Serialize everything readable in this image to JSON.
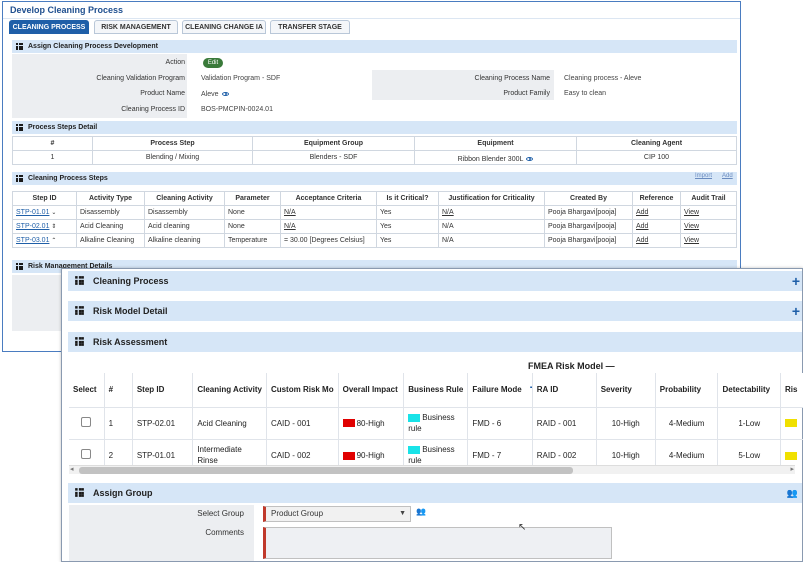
{
  "window": {
    "title": "Develop Cleaning Process"
  },
  "tabs": [
    "CLEANING PROCESS",
    "RISK MANAGEMENT",
    "CLEANING CHANGE IA",
    "TRANSFER STAGE"
  ],
  "assign_section": {
    "title": "Assign Cleaning Process Development",
    "action_label": "Action",
    "edit_label": "Edit",
    "fields": {
      "validation_program_label": "Cleaning Validation Program",
      "validation_program_value": "Validation Program - SDF",
      "product_name_label": "Product Name",
      "product_name_value": "Aleve",
      "process_id_label": "Cleaning Process ID",
      "process_id_value": "BOS-PMCPIN-0024.01",
      "process_name_label": "Cleaning Process Name",
      "process_name_value": "Cleaning process - Aleve",
      "product_family_label": "Product Family",
      "product_family_value": "Easy to clean"
    }
  },
  "steps_detail": {
    "title": "Process Steps Detail",
    "headers": [
      "#",
      "Process Step",
      "Equipment Group",
      "Equipment",
      "Cleaning Agent"
    ],
    "row": [
      "1",
      "Blending / Mixing",
      "Blenders - SDF",
      "Ribbon Blender 300L",
      "CIP 100"
    ]
  },
  "cleaning_steps": {
    "title": "Cleaning Process Steps",
    "import_label": "Import",
    "add_label": "Add",
    "headers": [
      "Step ID",
      "Activity Type",
      "Cleaning Activity",
      "Parameter",
      "Acceptance Criteria",
      "Is it Critical?",
      "Justification for Criticality",
      "Created By",
      "Reference",
      "Audit Trail"
    ],
    "rows": [
      [
        "STP-01.01",
        "Disassembly",
        "Disassembly",
        "None",
        "N/A",
        "Yes",
        "N/A",
        "Pooja Bhargavi[pooja]",
        "Add",
        "View"
      ],
      [
        "STP-02.01",
        "Acid Cleaning",
        "Acid cleaning",
        "None",
        "N/A",
        "Yes",
        "N/A",
        "Pooja Bhargavi[pooja]",
        "Add",
        "View"
      ],
      [
        "STP-03.01",
        "Alkaline Cleaning",
        "Alkaline cleaning",
        "Temperature",
        "= 30.00 [Degrees Celsius]",
        "Yes",
        "N/A",
        "Pooja Bhargavi[pooja]",
        "Add",
        "View"
      ]
    ]
  },
  "risk_mgmt_details": {
    "title": "Risk Management Details"
  },
  "overlay": {
    "sections": {
      "cleaning_process": "Cleaning Process",
      "risk_model_detail": "Risk Model Detail",
      "risk_assessment": "Risk Assessment",
      "assign_group": "Assign Group"
    },
    "fmea_label": "FMEA Risk Model —",
    "headers": [
      "Select",
      "#",
      "Step ID",
      "Cleaning Activity",
      "Custom Risk Mo",
      "Overall Impact",
      "Business Rule",
      "Failure Mode",
      "RA ID",
      "Severity",
      "Probability",
      "Detectability",
      "Ris"
    ],
    "rows": [
      {
        "num": "1",
        "step": "STP-02.01",
        "activity": "Acid Cleaning",
        "custom": "CAID - 001",
        "impact": "80-High",
        "rule": "Business rule",
        "failure": "FMD - 6",
        "ra": "RAID - 001",
        "severity": "10-High",
        "probability": "4-Medium",
        "detect": "1-Low"
      },
      {
        "num": "2",
        "step": "STP-01.01",
        "activity": "Intermediate Rinse",
        "custom": "CAID - 002",
        "impact": "90-High",
        "rule": "Business rule",
        "failure": "FMD - 7",
        "ra": "RAID - 002",
        "severity": "10-High",
        "probability": "4-Medium",
        "detect": "5-Low"
      }
    ],
    "select_group_label": "Select Group",
    "select_group_value": "Product Group",
    "comments_label": "Comments"
  },
  "colors": {
    "tab_active": "#1f5fa8",
    "header_bg": "#d6e6f7",
    "impact_red": "#e00000",
    "rule_cyan": "#19e3e8",
    "yellow": "#f0e000"
  }
}
